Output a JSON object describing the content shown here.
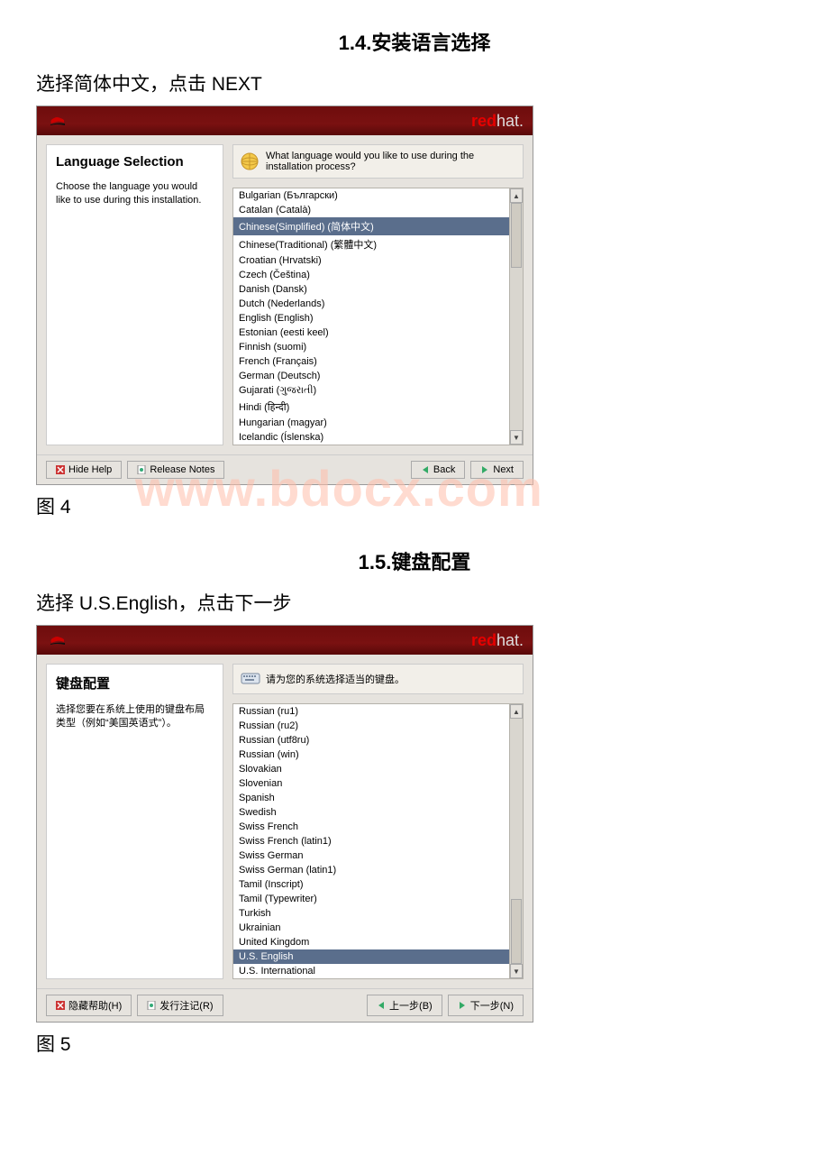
{
  "doc": {
    "section1_title": "1.4.安装语言选择",
    "section1_instruction": "选择简体中文，点击 NEXT",
    "fig4": "图 4",
    "watermark": "www.bdocx.com",
    "section2_title": "1.5.键盘配置",
    "section2_instruction": "选择 U.S.English，点击下一步",
    "fig5": "图 5"
  },
  "brand": {
    "red": "red",
    "hat": "hat."
  },
  "lang": {
    "side_title": "Language Selection",
    "side_desc": "Choose the language you would like to use during this installation.",
    "prompt": "What language would you like to use during the installation process?",
    "items": [
      "Bulgarian (Български)",
      "Catalan (Català)",
      "Chinese(Simplified) (简体中文)",
      "Chinese(Traditional) (繁體中文)",
      "Croatian (Hrvatski)",
      "Czech (Čeština)",
      "Danish (Dansk)",
      "Dutch (Nederlands)",
      "English (English)",
      "Estonian (eesti keel)",
      "Finnish (suomi)",
      "French (Français)",
      "German (Deutsch)",
      "Gujarati (ગુજરાતી)",
      "Hindi (हिन्दी)",
      "Hungarian (magyar)",
      "Icelandic (Íslenska)"
    ],
    "selected_index": 2,
    "footer": {
      "hide": "Hide Help",
      "release": "Release Notes",
      "back": "Back",
      "next": "Next"
    }
  },
  "kbd": {
    "side_title": "键盘配置",
    "side_desc": "选择您要在系统上使用的键盘布局类型（例如“美国英语式”）。",
    "prompt": "请为您的系统选择适当的键盘。",
    "items": [
      "Russian (ru1)",
      "Russian (ru2)",
      "Russian (utf8ru)",
      "Russian (win)",
      "Slovakian",
      "Slovenian",
      "Spanish",
      "Swedish",
      "Swiss French",
      "Swiss French (latin1)",
      "Swiss German",
      "Swiss German (latin1)",
      "Tamil (Inscript)",
      "Tamil (Typewriter)",
      "Turkish",
      "Ukrainian",
      "United Kingdom",
      "U.S. English",
      "U.S. International"
    ],
    "selected_index": 17,
    "footer": {
      "hide": "隐藏帮助(H)",
      "release": "发行注记(R)",
      "back": "上一步(B)",
      "next": "下一步(N)"
    }
  }
}
